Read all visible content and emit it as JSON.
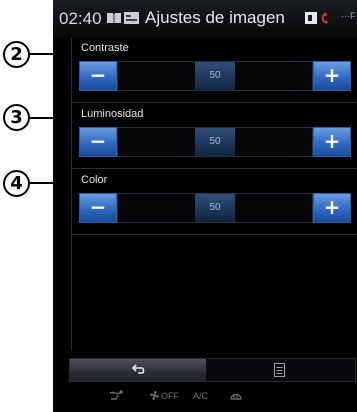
{
  "header": {
    "time": "02:40",
    "title": "Ajustes de imagen",
    "status_right": "···F"
  },
  "callouts": [
    "2",
    "3",
    "4"
  ],
  "settings": [
    {
      "label": "Contraste",
      "value": "50",
      "minus": "−",
      "plus": "+"
    },
    {
      "label": "Luminosidad",
      "value": "50",
      "minus": "−",
      "plus": "+"
    },
    {
      "label": "Color",
      "value": "50",
      "minus": "−",
      "plus": "+"
    }
  ],
  "footer": {
    "back_icon": "back-arrow-icon",
    "menu_icon": "menu-list-icon"
  },
  "climate": {
    "fan_off": "OFF",
    "ac": "A/C"
  },
  "colors": {
    "button_blue": "#2f69c4",
    "slider_thumb": "#1d3659",
    "background": "#000000"
  }
}
